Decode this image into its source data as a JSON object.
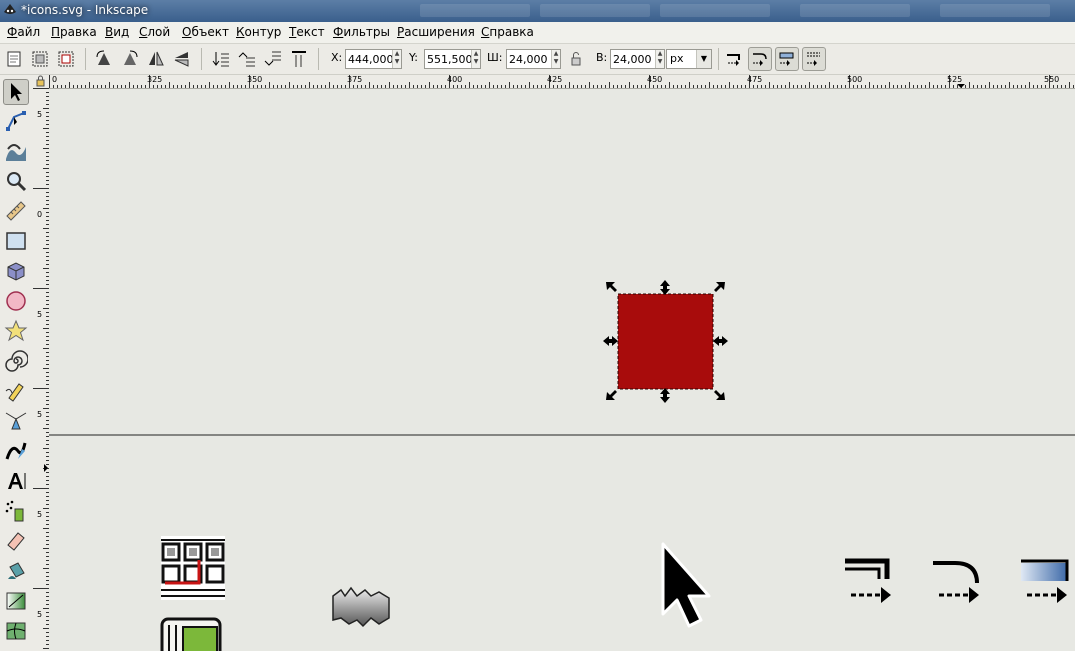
{
  "window": {
    "title": "*icons.svg - Inkscape"
  },
  "menu": [
    "Файл",
    "Правка",
    "Вид",
    "Слой",
    "Объект",
    "Контур",
    "Текст",
    "Фильтры",
    "Расширения",
    "Справка"
  ],
  "toolbar": {
    "x_label": "X:",
    "x_value": "444,000",
    "y_label": "Y:",
    "y_value": "551,500",
    "w_label": "Ш:",
    "w_value": "24,000",
    "h_label": "В:",
    "h_value": "24,000",
    "unit": "px"
  },
  "ruler": {
    "h_labels": [
      "0",
      "325",
      "350",
      "375",
      "400",
      "425",
      "450",
      "475",
      "500",
      "525",
      "550"
    ],
    "v_labels": [
      "5",
      "0",
      "5",
      "5",
      "5",
      "5"
    ]
  },
  "colors": {
    "selected_square": "#a80c0c",
    "canvas": "#e7e8e3",
    "accent_red": "#c81414",
    "icon_green": "#7cb83a"
  },
  "tools": [
    "selector-icon",
    "node-editor-icon",
    "tweak-icon",
    "zoom-icon",
    "measure-icon",
    "rectangle-icon",
    "3d-box-icon",
    "ellipse-icon",
    "star-icon",
    "spiral-icon",
    "pencil-icon",
    "pen-icon",
    "calligraphy-icon",
    "text-icon",
    "spray-icon",
    "eraser-icon",
    "paint-bucket-icon",
    "gradient-icon",
    "mesh-icon"
  ]
}
